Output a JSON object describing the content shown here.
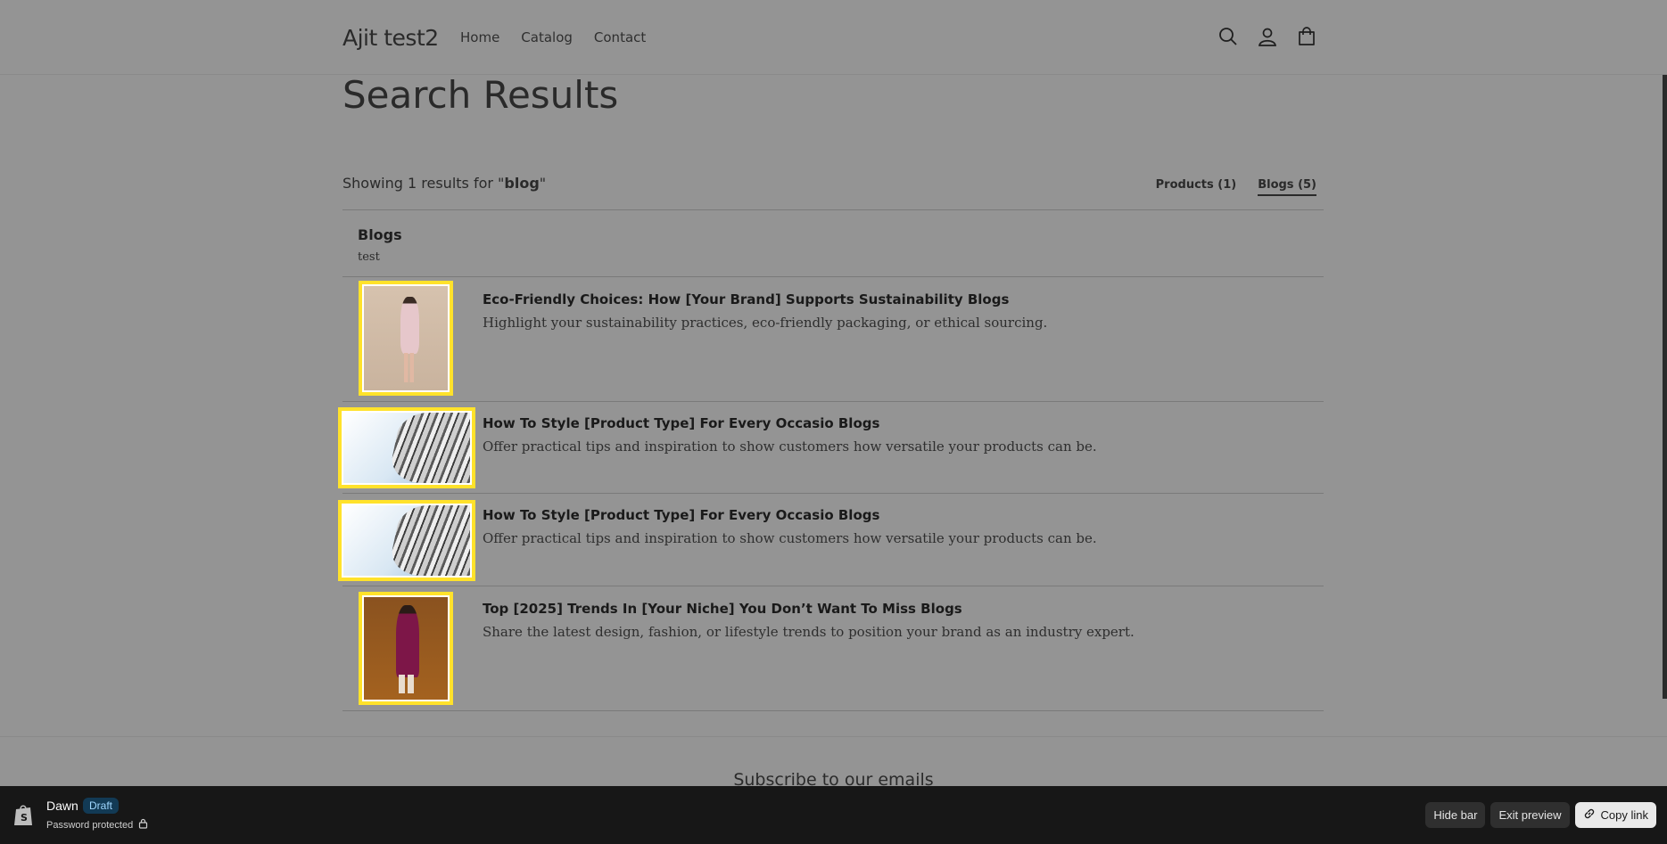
{
  "store": {
    "name": "Ajit test2"
  },
  "nav": {
    "items": [
      "Home",
      "Catalog",
      "Contact"
    ]
  },
  "page": {
    "title": "Search Results"
  },
  "results": {
    "prefix": "Showing 1 results for \"",
    "query": "blog",
    "suffix": "\"",
    "tabs": [
      {
        "label": "Products (1)",
        "active": false
      },
      {
        "label": "Blogs (5)",
        "active": true
      }
    ]
  },
  "group": {
    "title": "Blogs",
    "subtitle": "test"
  },
  "articles": [
    {
      "title": "Eco-Friendly Choices: How [Your Brand] Supports Sustainability Blogs",
      "description": "Highlight your sustainability practices, eco-friendly packaging, or ethical sourcing.",
      "image": "woman-pink-dress"
    },
    {
      "title": "How To Style [Product Type] For Every Occasio Blogs",
      "description": "Offer practical tips and inspiration to show customers how versatile your products can be.",
      "image": "silver-watch-band"
    },
    {
      "title": "How To Style [Product Type] For Every Occasio Blogs",
      "description": "Offer practical tips and inspiration to show customers how versatile your products can be.",
      "image": "silver-watch-band"
    },
    {
      "title": "Top [2025] Trends In [Your Niche] You Don’t Want To Miss Blogs",
      "description": "Share the latest design, fashion, or lifestyle trends to position your brand as an industry expert.",
      "image": "woman-purple-dress"
    }
  ],
  "footer": {
    "subscribe_heading": "Subscribe to our emails"
  },
  "preview_bar": {
    "theme_name": "Dawn",
    "status_badge": "Draft",
    "password_text": "Password protected",
    "hide_bar": "Hide bar",
    "exit_preview": "Exit preview",
    "copy_link": "Copy link"
  },
  "colors": {
    "highlight": "#ffe22b",
    "bar_bg": "#171717",
    "overlay": "#949494"
  }
}
